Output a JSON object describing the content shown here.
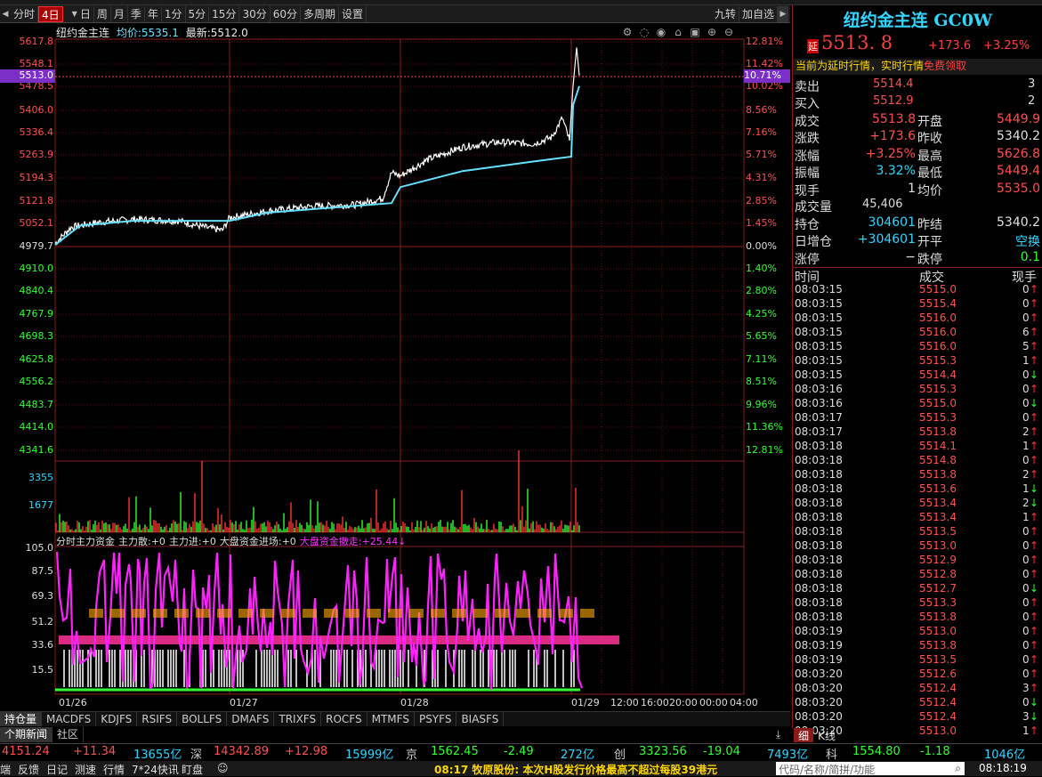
{
  "toolbar": {
    "items": [
      "分时",
      "4日",
      "日",
      "周",
      "月",
      "季",
      "年",
      "1分",
      "5分",
      "15分",
      "30分",
      "60分",
      "多周期",
      "设置"
    ],
    "active": "4日",
    "right": [
      "九转",
      "加自选"
    ]
  },
  "chart_header": {
    "name": "纽约金主连",
    "avg_label": "均价:",
    "avg": "5535.1",
    "last_label": "最新:",
    "last": "5512.0"
  },
  "price_axis": [
    "5617.8",
    "5548.1",
    "5478.5",
    "5406.0",
    "5336.4",
    "5263.9",
    "5194.3",
    "5121.8",
    "5052.1",
    "4979.7",
    "4910.0",
    "4840.4",
    "4767.9",
    "4698.3",
    "4625.8",
    "4556.2",
    "4483.7",
    "4414.0",
    "4341.6"
  ],
  "current_price_tag": "5513.0",
  "current_pct_tag": "10.71%",
  "pct_axis": [
    "12.81%",
    "11.42%",
    "10.02%",
    "8.56%",
    "7.16%",
    "5.71%",
    "4.31%",
    "2.85%",
    "1.45%",
    "0.00%",
    "1.40%",
    "2.80%",
    "4.25%",
    "5.65%",
    "7.11%",
    "8.51%",
    "9.96%",
    "11.36%",
    "12.81%"
  ],
  "volume_axis": [
    "3355",
    "1677"
  ],
  "indicator": {
    "title": "分时主力资金",
    "items": [
      {
        "label": "主力散:",
        "value": "+0"
      },
      {
        "label": "主力进:",
        "value": "+0"
      },
      {
        "label": "大盘资金进场:",
        "value": "+0"
      },
      {
        "label": "大盘资金撤走:",
        "value": "+25.44↓"
      }
    ],
    "axis": [
      "105.0",
      "87.5",
      "69.3",
      "51.2",
      "33.6",
      "15.5"
    ]
  },
  "date_axis": [
    "01/26",
    "01/27",
    "01/28",
    "01/29",
    "12:00",
    "16:00",
    "20:00",
    "00:00",
    "04:00"
  ],
  "bottom_tabs": [
    "持仓量",
    "MACDFS",
    "KDJFS",
    "RSIFS",
    "BOLLFS",
    "DMAFS",
    "TRIXFS",
    "ROCFS",
    "MTMFS",
    "PSYFS",
    "BIASFS"
  ],
  "bottom_tabs2": [
    "个期新闻",
    "社区"
  ],
  "quote": {
    "title": "纽约金主连 GC0W",
    "delay_tag": "延",
    "price": "5513. 8",
    "change": "+173.6",
    "change_pct": "+3.25%",
    "notice": "当前为延时行情，实时行情",
    "notice_link": "免费领取",
    "sell": {
      "label": "卖出",
      "price": "5514.4",
      "qty": "3"
    },
    "buy": {
      "label": "买入",
      "price": "5512.9",
      "qty": "2"
    },
    "stats": [
      {
        "l1": "成交",
        "v1": "5513.8",
        "l2": "开盘",
        "v2": "5449.9",
        "c1": "#ff5050",
        "c2": "#ff5050"
      },
      {
        "l1": "涨跌",
        "v1": "+173.6",
        "l2": "昨收",
        "v2": "5340.2",
        "c1": "#ff5050",
        "c2": "#e0e0e0"
      },
      {
        "l1": "涨幅",
        "v1": "+3.25%",
        "l2": "最高",
        "v2": "5626.8",
        "c1": "#ff5050",
        "c2": "#ff5050"
      },
      {
        "l1": "振幅",
        "v1": "3.32%",
        "l2": "最低",
        "v2": "5449.4",
        "c1": "#33d6ff",
        "c2": "#ff5050"
      },
      {
        "l1": "现手",
        "v1": "1",
        "l2": "均价",
        "v2": "5535.0",
        "c1": "#e0e0e0",
        "c2": "#ff5050"
      }
    ],
    "volume": {
      "label": "成交量",
      "value": "45,406"
    },
    "oi": [
      {
        "l1": "持仓",
        "v1": "304601",
        "l2": "昨结",
        "v2": "5340.2",
        "c1": "#33d6ff",
        "c2": "#e0e0e0"
      },
      {
        "l1": "日增仓",
        "v1": "+304601",
        "l2": "开平",
        "v2": "空换",
        "c1": "#33d6ff",
        "c2": "#33d6ff"
      },
      {
        "l1": "涨停",
        "v1": "−",
        "l2": "跌停",
        "v2": "0.1",
        "c1": "#e0e0e0",
        "c2": "#33ff33"
      }
    ],
    "tape_headers": [
      "时间",
      "成交",
      "现手"
    ],
    "tape": [
      [
        "08:03:15",
        "5515.0",
        "0",
        "up"
      ],
      [
        "08:03:15",
        "5515.4",
        "0",
        "up"
      ],
      [
        "08:03:15",
        "5516.0",
        "0",
        "up"
      ],
      [
        "08:03:15",
        "5516.0",
        "6",
        "up"
      ],
      [
        "08:03:15",
        "5516.0",
        "5",
        "up"
      ],
      [
        "08:03:15",
        "5515.3",
        "1",
        "up"
      ],
      [
        "08:03:15",
        "5514.4",
        "0",
        "down"
      ],
      [
        "08:03:16",
        "5515.3",
        "0",
        "up"
      ],
      [
        "08:03:16",
        "5515.0",
        "0",
        "down"
      ],
      [
        "08:03:17",
        "5515.3",
        "0",
        "up"
      ],
      [
        "08:03:17",
        "5513.8",
        "2",
        "up"
      ],
      [
        "08:03:18",
        "5514.1",
        "1",
        "up"
      ],
      [
        "08:03:18",
        "5514.8",
        "0",
        "up"
      ],
      [
        "08:03:18",
        "5513.8",
        "2",
        "up"
      ],
      [
        "08:03:18",
        "5513.6",
        "1",
        "down"
      ],
      [
        "08:03:18",
        "5513.4",
        "2",
        "down"
      ],
      [
        "08:03:18",
        "5513.4",
        "1",
        "up"
      ],
      [
        "08:03:18",
        "5513.5",
        "0",
        "up"
      ],
      [
        "08:03:18",
        "5513.0",
        "0",
        "up"
      ],
      [
        "08:03:18",
        "5512.9",
        "0",
        "up"
      ],
      [
        "08:03:18",
        "5512.8",
        "0",
        "up"
      ],
      [
        "08:03:18",
        "5512.7",
        "0",
        "down"
      ],
      [
        "08:03:18",
        "5513.3",
        "0",
        "up"
      ],
      [
        "08:03:18",
        "5513.8",
        "0",
        "up"
      ],
      [
        "08:03:19",
        "5513.0",
        "0",
        "up"
      ],
      [
        "08:03:19",
        "5513.8",
        "0",
        "up"
      ],
      [
        "08:03:19",
        "5513.5",
        "0",
        "up"
      ],
      [
        "08:03:20",
        "5512.6",
        "0",
        "up"
      ],
      [
        "08:03:20",
        "5512.4",
        "3",
        "up"
      ],
      [
        "08:03:20",
        "5512.4",
        "0",
        "down"
      ],
      [
        "08:03:20",
        "5512.4",
        "3",
        "down"
      ],
      [
        "08:03:20",
        "5513.0",
        "1",
        "up"
      ]
    ],
    "tabs": [
      "细",
      "K线"
    ]
  },
  "status_bar": {
    "sh": {
      "price": "4151.24",
      "chg": "+11.34",
      "amt": "13655亿"
    },
    "sz": {
      "name": "深",
      "price": "14342.89",
      "chg": "+12.98",
      "amt": "15999亿"
    },
    "bj": {
      "name": "京",
      "price": "1562.45",
      "chg": "-2.49",
      "amt": "272亿"
    },
    "cy": {
      "name": "创",
      "price": "3323.56",
      "chg": "-19.04",
      "amt": "7493亿"
    },
    "kc": {
      "name": "科",
      "price": "1554.80",
      "chg": "-1.18",
      "amt": "1046亿"
    }
  },
  "bottom_bar": {
    "items": [
      "端",
      "反馈",
      "日记",
      "测速",
      "行情",
      "7*24快讯",
      "盯盘"
    ],
    "news": "08:17 牧原股份: 本次H股发行价格最高不超过每股39港元",
    "search_placeholder": "代码/名称/简拼/功能",
    "time": "08:18:19"
  },
  "colors": {
    "up": "#ff3333",
    "down": "#33ff33",
    "avg": "#66e0ff",
    "magenta": "#ff33ff",
    "grid": "#7a0e0e"
  }
}
